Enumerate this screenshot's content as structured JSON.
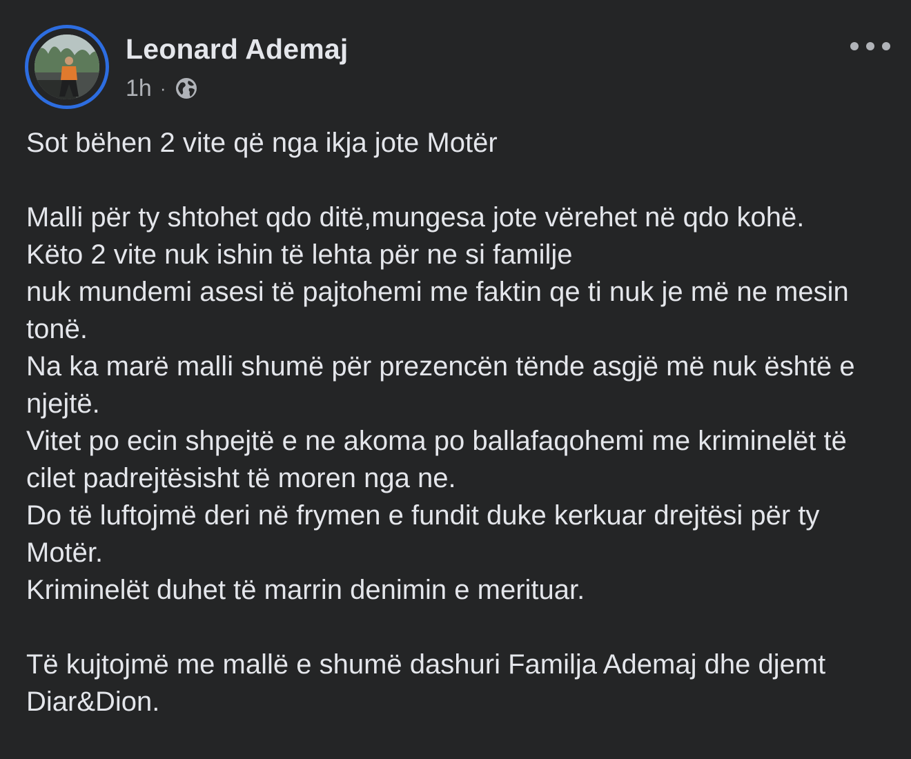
{
  "post": {
    "author": "Leonard Ademaj",
    "time": "1h",
    "separator": "·",
    "privacy_icon": "globe-icon",
    "more_icon": "more-options-icon",
    "avatar": "profile-photo",
    "body": "Sot bëhen 2 vite që nga ikja jote Motër\n\nMalli për ty shtohet qdo ditë,mungesa jote vërehet në qdo kohë.\nKëto 2 vite nuk ishin të lehta për ne si familje\nnuk mundemi asesi të pajtohemi me faktin qe ti nuk je më ne mesin tonë.\nNa ka marë malli shumë për prezencën tënde asgjë më nuk është e njejtë.\nVitet po ecin shpejtë e ne akoma po ballafaqohemi me kriminelët të cilet padrejtësisht të moren nga ne.\nDo të luftojmë deri në frymen e fundit duke kerkuar drejtësi për ty Motër.\nKriminelët duhet të marrin denimin e merituar.\n\nTë kujtojmë me mallë e shumë dashuri Familja Ademaj dhe djemt Diar&Dion.",
    "colors": {
      "background": "#242526",
      "text": "#e4e6eb",
      "secondary": "#b0b3b8",
      "story_ring": "#2d6de0"
    }
  }
}
